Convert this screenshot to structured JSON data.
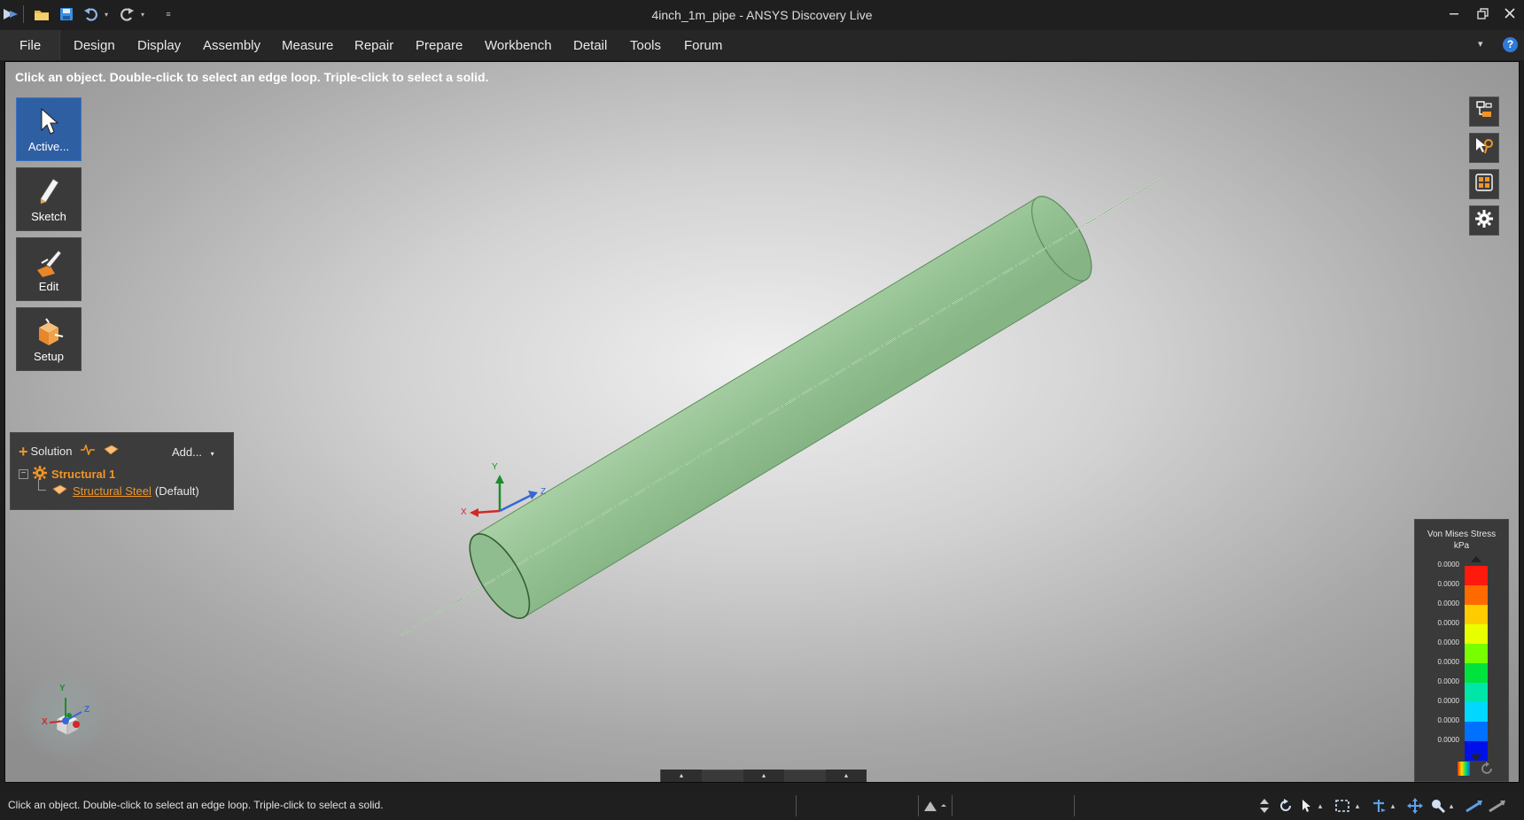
{
  "window": {
    "title": "4inch_1m_pipe - ANSYS Discovery Live"
  },
  "menu": {
    "file": "File",
    "items": [
      "Design",
      "Display",
      "Assembly",
      "Measure",
      "Repair",
      "Prepare",
      "Workbench",
      "Detail",
      "Tools",
      "Forum"
    ]
  },
  "viewport": {
    "hint": "Click an object. Double-click to select an edge loop. Triple-click to select a solid."
  },
  "tools": [
    {
      "label": "Active...",
      "icon": "arrow-cursor-icon",
      "active": true
    },
    {
      "label": "Sketch",
      "icon": "pencil-icon",
      "active": false
    },
    {
      "label": "Edit",
      "icon": "edit-pull-icon",
      "active": false
    },
    {
      "label": "Setup",
      "icon": "setup-box-icon",
      "active": false
    }
  ],
  "solution": {
    "header": "Solution",
    "add_label": "Add...",
    "tree": [
      {
        "label": "Structural 1",
        "icon": "gear-icon",
        "color": "#f0952a"
      },
      {
        "label": "Structural Steel",
        "suffix": "(Default)",
        "icon": "material-icon",
        "link_color": "#f0952a"
      }
    ]
  },
  "triad": {
    "x": "X",
    "y": "Y",
    "z": "Z"
  },
  "legend": {
    "title": "Von Mises Stress",
    "unit": "kPa",
    "ticks": [
      "0.0000",
      "0.0000",
      "0.0000",
      "0.0000",
      "0.0000",
      "0.0000",
      "0.0000",
      "0.0000",
      "0.0000",
      "0.0000"
    ],
    "colors": [
      "#ff1a0d",
      "#ff6a00",
      "#ffcc00",
      "#e8ff00",
      "#77ff00",
      "#00e23c",
      "#00e6a8",
      "#00d8ff",
      "#0070ff",
      "#0010e8"
    ]
  },
  "right_toolbar": [
    "structure-tree-icon",
    "selection-icon",
    "display-options-icon",
    "settings-gear-icon"
  ],
  "sim_strip": [
    "play-icon",
    "reset-icon",
    "solid-box-icon",
    "section-box-icon",
    "path-icon"
  ],
  "status": {
    "text": "Click an object. Double-click to select an edge loop. Triple-click to select a solid."
  },
  "colors": {
    "accent": "#2f5fa3",
    "highlight": "#f0952a",
    "pipe": "#9bc49b"
  }
}
